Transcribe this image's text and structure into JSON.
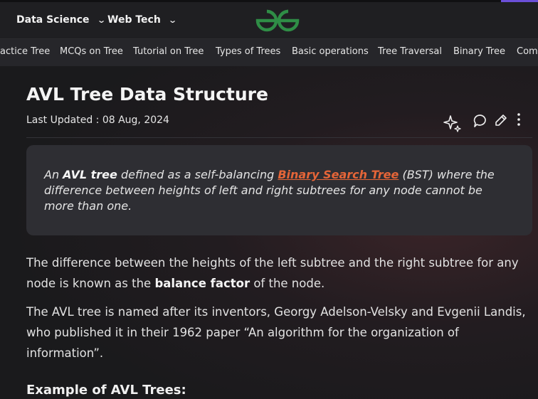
{
  "nav": {
    "items": [
      "Data Science",
      "Web Tech"
    ]
  },
  "colors": {
    "brand_green": "#2f8d46",
    "link": "#e56538",
    "accent_purple": "#6b4fd8"
  },
  "subnav": {
    "items": [
      "actice Tree",
      "MCQs on Tree",
      "Tutorial on Tree",
      "Types of Trees",
      "Basic operations",
      "Tree Traversal",
      "Binary Tree",
      "Com"
    ]
  },
  "article": {
    "title": "AVL Tree Data Structure",
    "last_updated": "Last Updated : 08 Aug, 2024",
    "toolbar_icons": [
      "sparkle-icon",
      "comment-icon",
      "edit-icon",
      "more-vertical-icon"
    ],
    "quote": {
      "t1": "An ",
      "b1": "AVL tree",
      "t2": " defined as a self-balancing ",
      "link": "Binary Search Tree",
      "t3": " (BST) where the difference between heights of left and right subtrees for any node cannot be more than one."
    },
    "para1": {
      "t1": "The difference between the heights of the left subtree and the right subtree for any node is known as the ",
      "b1": "balance factor",
      "t2": " of the node."
    },
    "para2": "The AVL tree is named after its inventors, Georgy Adelson-Velsky and Evgenii Landis, who published it in their 1962 paper “An algorithm for the organization of information”.",
    "heading": "Example of AVL Trees:"
  }
}
